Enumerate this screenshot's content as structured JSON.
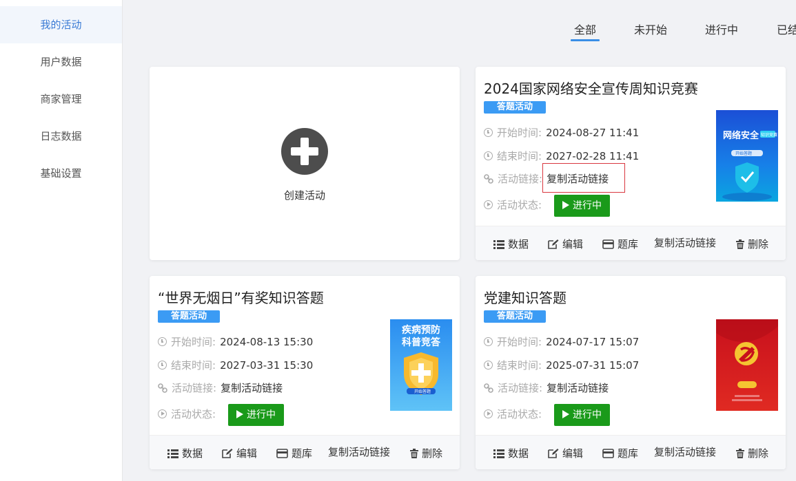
{
  "sidebar": {
    "items": [
      {
        "label": "我的活动",
        "active": true
      },
      {
        "label": "用户数据"
      },
      {
        "label": "商家管理"
      },
      {
        "label": "日志数据"
      },
      {
        "label": "基础设置"
      }
    ]
  },
  "tabs": [
    {
      "label": "全部",
      "active": true
    },
    {
      "label": "未开始"
    },
    {
      "label": "进行中"
    },
    {
      "label": "已结"
    }
  ],
  "create": {
    "label": "创建活动",
    "icon": "plus-circle-icon"
  },
  "labels": {
    "start": "开始时间:",
    "end": "结束时间:",
    "link": "活动链接:",
    "status": "活动状态:"
  },
  "footer": {
    "data": "数据",
    "edit": "编辑",
    "bank": "题库",
    "copy": "复制活动链接",
    "delete": "删除"
  },
  "activities": [
    {
      "title": "2024国家网络安全宣传周知识竞赛",
      "badge": "答题活动",
      "start": "2024-08-27 11:41",
      "end": "2027-02-28 11:41",
      "link": "复制活动链接",
      "status": "进行中",
      "thumb": {
        "line1": "网络安全",
        "tag": "知识竞赛",
        "button": "开始答题"
      }
    },
    {
      "title": "“世界无烟日”有奖知识答题",
      "badge": "答题活动",
      "start": "2024-08-13 15:30",
      "end": "2027-03-31 15:30",
      "link": "复制活动链接",
      "status": "进行中",
      "thumb": {
        "line1": "疾病预防",
        "line2": "科普竞答",
        "button": "开始答题"
      }
    },
    {
      "title": "党建知识答题",
      "badge": "答题活动",
      "start": "2024-07-17 15:07",
      "end": "2025-07-31 15:07",
      "link": "复制活动链接",
      "status": "进行中",
      "thumb": {}
    }
  ],
  "colors": {
    "accent": "#3a8ee6",
    "badge": "#3b9bf4",
    "status": "#1a9a1a",
    "highlight": "#d9363e"
  }
}
